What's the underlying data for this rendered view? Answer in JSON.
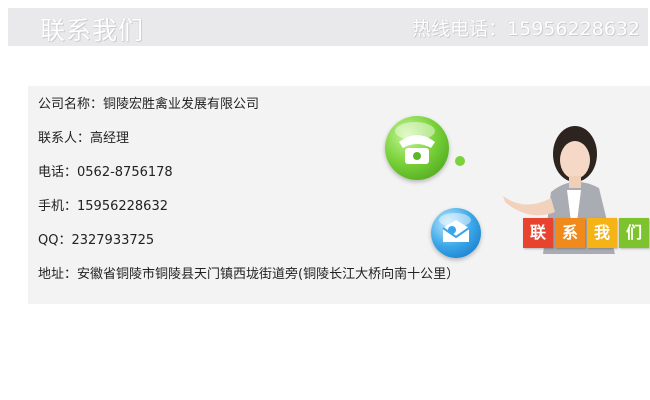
{
  "header": {
    "title": "联系我们",
    "hotline": "热线电话：15956228632"
  },
  "contact": [
    {
      "label": "公司名称：",
      "value": "铜陵宏胜禽业发展有限公司"
    },
    {
      "label": "联系人：",
      "value": "高经理"
    },
    {
      "label": "电话：",
      "value": "0562-8756178"
    },
    {
      "label": "手机：",
      "value": "15956228632"
    },
    {
      "label": "QQ：",
      "value": "2327933725"
    },
    {
      "label": "地址：",
      "value": "安徽省铜陵市铜陵县天门镇西垅街道旁(铜陵长江大桥向南十公里）"
    }
  ],
  "illustration": {
    "icons": [
      "telephone-icon",
      "mail-icon"
    ],
    "badges": [
      {
        "char": "联",
        "color": "#e8432f"
      },
      {
        "char": "系",
        "color": "#f08a1c"
      },
      {
        "char": "我",
        "color": "#f5b316"
      },
      {
        "char": "们",
        "color": "#7cc32d"
      }
    ]
  }
}
